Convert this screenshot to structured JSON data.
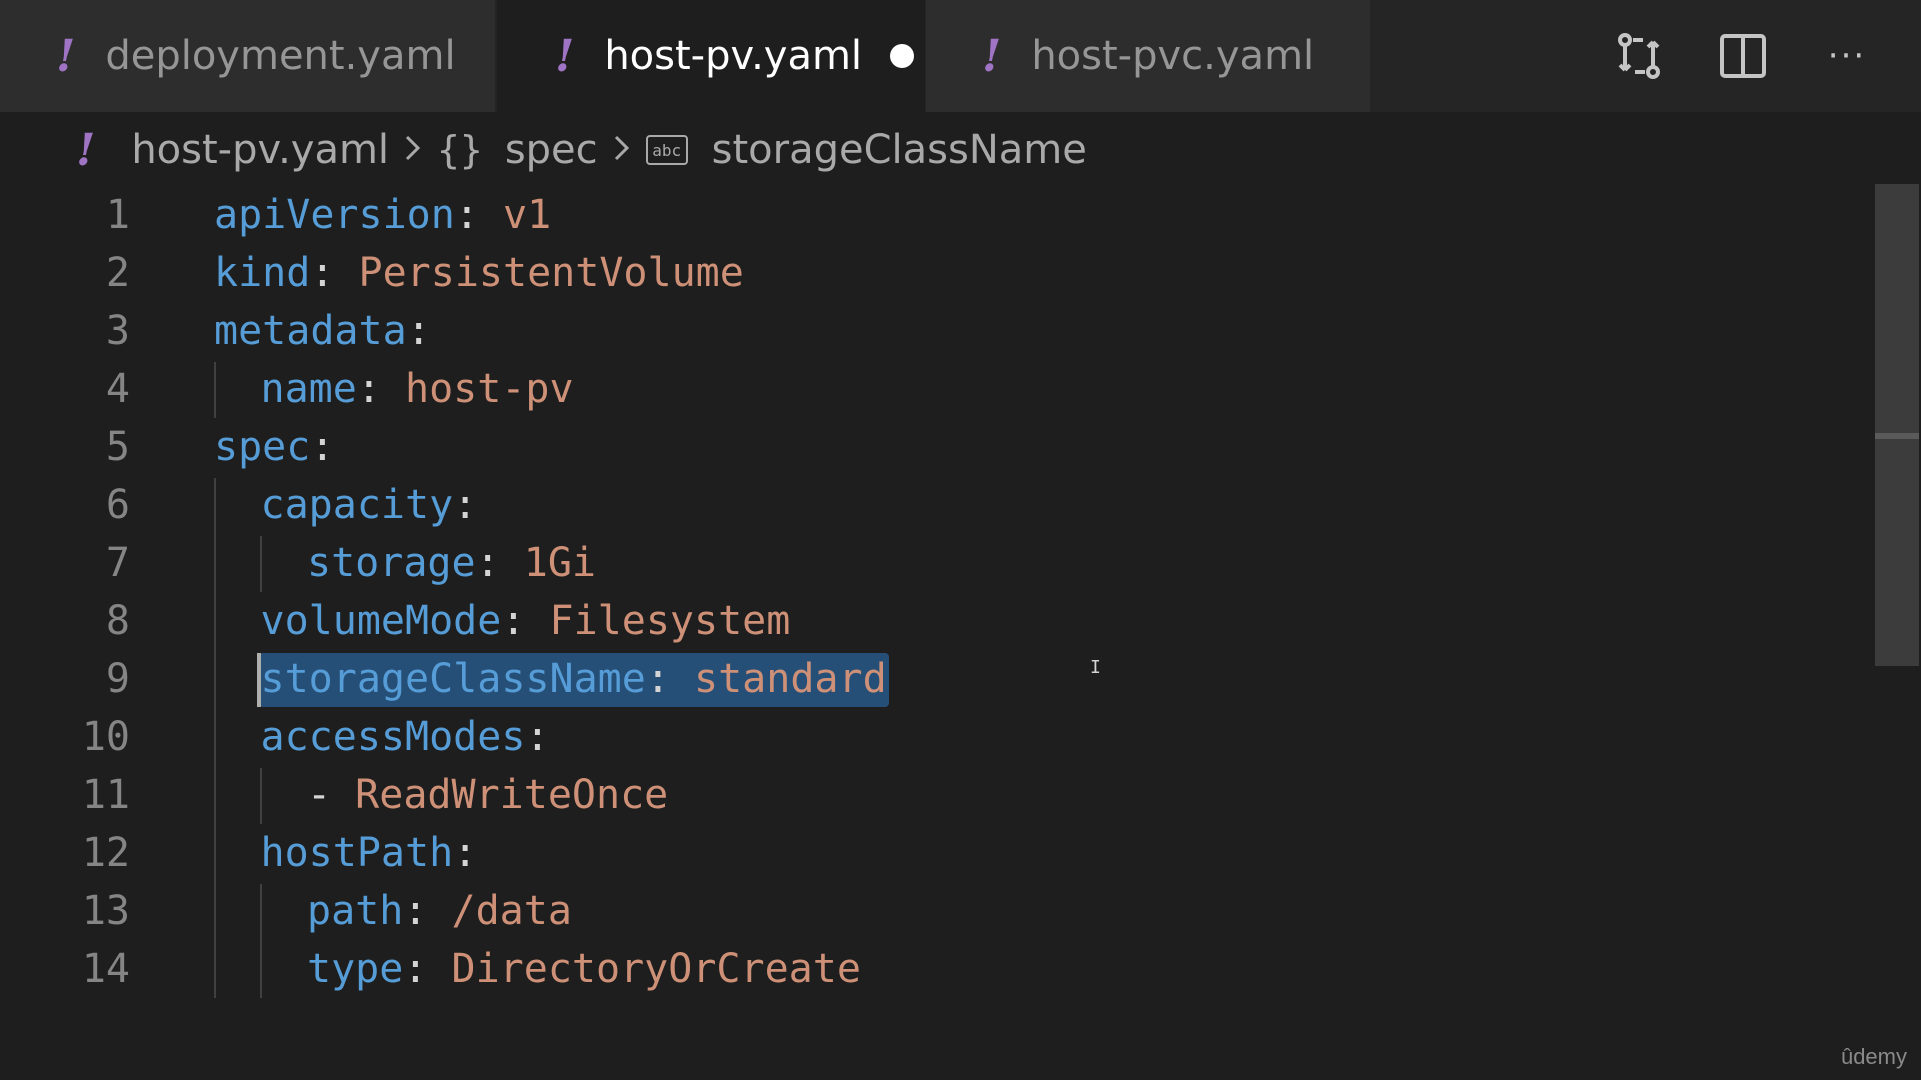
{
  "tabs": [
    {
      "label": "deployment.yaml",
      "icon": "yaml-icon",
      "active": false
    },
    {
      "label": "host-pv.yaml",
      "icon": "yaml-icon",
      "active": true,
      "dirty": true
    },
    {
      "label": "host-pvc.yaml",
      "icon": "yaml-icon",
      "active": false
    }
  ],
  "tab_icon_glyph": "!",
  "toolbar": {
    "actions": [
      "compare-changes-icon",
      "split-editor-icon",
      "more-actions-icon"
    ],
    "more_glyph": "···"
  },
  "breadcrumb": {
    "file": "host-pv.yaml",
    "braces": "{}",
    "section": "spec",
    "abc": "abc",
    "symbol": "storageClassName"
  },
  "editor": {
    "selected_line": 9,
    "lines": [
      {
        "n": "1",
        "key": "apiVersion",
        "sep": ":",
        "val": " v1"
      },
      {
        "n": "2",
        "key": "kind",
        "sep": ":",
        "val": " PersistentVolume"
      },
      {
        "n": "3",
        "key": "metadata",
        "sep": ":",
        "val": ""
      },
      {
        "n": "4",
        "key": "name",
        "sep": ":",
        "val": " host-pv"
      },
      {
        "n": "5",
        "key": "spec",
        "sep": ":",
        "val": ""
      },
      {
        "n": "6",
        "key": "capacity",
        "sep": ":",
        "val": ""
      },
      {
        "n": "7",
        "key": "storage",
        "sep": ":",
        "val": " 1Gi"
      },
      {
        "n": "8",
        "key": "volumeMode",
        "sep": ":",
        "val": " Filesystem"
      },
      {
        "n": "9",
        "key": "storageClassName",
        "sep": ":",
        "val": " standard"
      },
      {
        "n": "10",
        "key": "accessModes",
        "sep": ":",
        "val": ""
      },
      {
        "n": "11",
        "dash": "- ",
        "val": "ReadWriteOnce"
      },
      {
        "n": "12",
        "key": "hostPath",
        "sep": ":",
        "val": ""
      },
      {
        "n": "13",
        "key": "path",
        "sep": ":",
        "val": " /data"
      },
      {
        "n": "14",
        "key": "type",
        "sep": ":",
        "val": " DirectoryOrCreate"
      }
    ]
  },
  "colors": {
    "key": "#569cd6",
    "value": "#ce9178",
    "selection": "#264f78",
    "yaml_icon": "#a074c4"
  },
  "watermark": "ûdemy"
}
